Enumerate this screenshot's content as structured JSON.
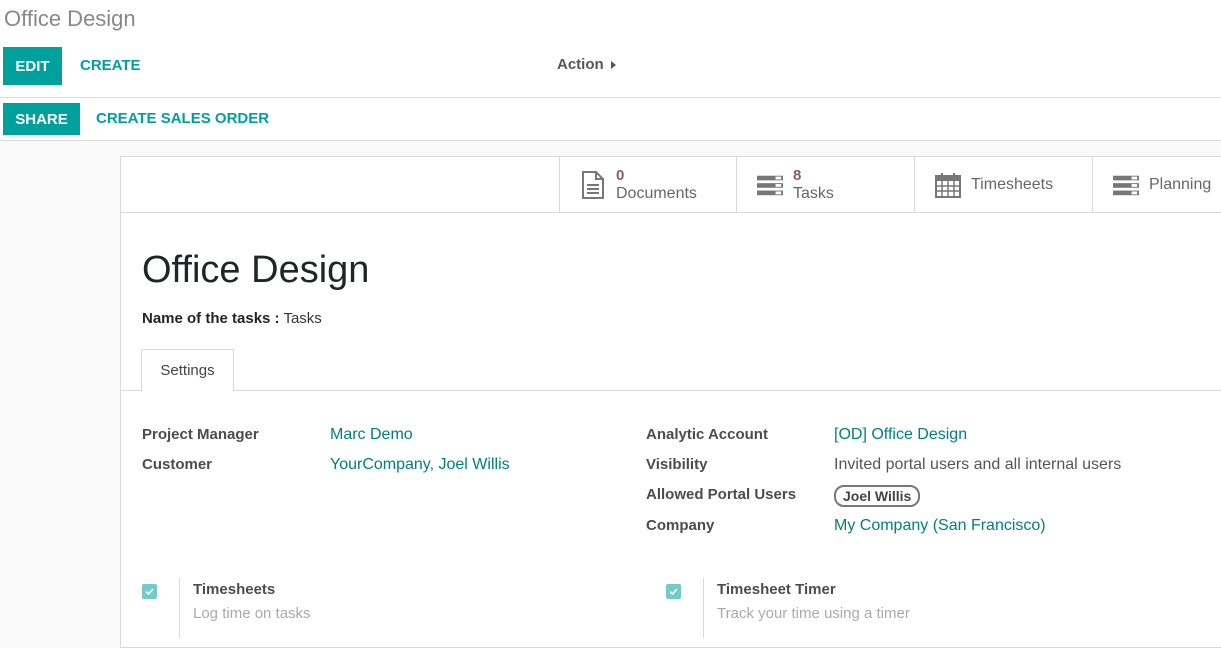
{
  "breadcrumb": "Office Design",
  "toolbar": {
    "edit": "EDIT",
    "create": "CREATE",
    "action": "Action",
    "share": "SHARE",
    "create_sales_order": "CREATE SALES ORDER"
  },
  "stat_buttons": [
    {
      "value": "0",
      "label": "Documents",
      "icon": "document-icon"
    },
    {
      "value": "8",
      "label": "Tasks",
      "icon": "tasks-icon"
    },
    {
      "value": "",
      "label": "Timesheets",
      "icon": "calendar-icon"
    },
    {
      "value": "",
      "label": "Planning",
      "icon": "planning-icon"
    }
  ],
  "form": {
    "title": "Office Design",
    "task_name_label": "Name of the tasks :",
    "task_name_value": "Tasks",
    "tab": "Settings",
    "fields_left": [
      {
        "label": "Project Manager",
        "value": "Marc Demo"
      },
      {
        "label": "Customer",
        "value": "YourCompany, Joel Willis"
      }
    ],
    "fields_right": {
      "analytic_account_label": "Analytic Account",
      "analytic_account_value": "[OD] Office Design",
      "visibility_label": "Visibility",
      "visibility_value": "Invited portal users and all internal users",
      "portal_users_label": "Allowed Portal Users",
      "portal_users_tag": "Joel Willis",
      "company_label": "Company",
      "company_value": "My Company (San Francisco)"
    },
    "settings": [
      {
        "title": "Timesheets",
        "description": "Log time on tasks",
        "checked": true
      },
      {
        "title": "Timesheet Timer",
        "description": "Track your time using a timer",
        "checked": true
      }
    ]
  },
  "colors": {
    "primary": "#00a09d",
    "link": "#00807d",
    "stat_value": "#875a7b"
  }
}
